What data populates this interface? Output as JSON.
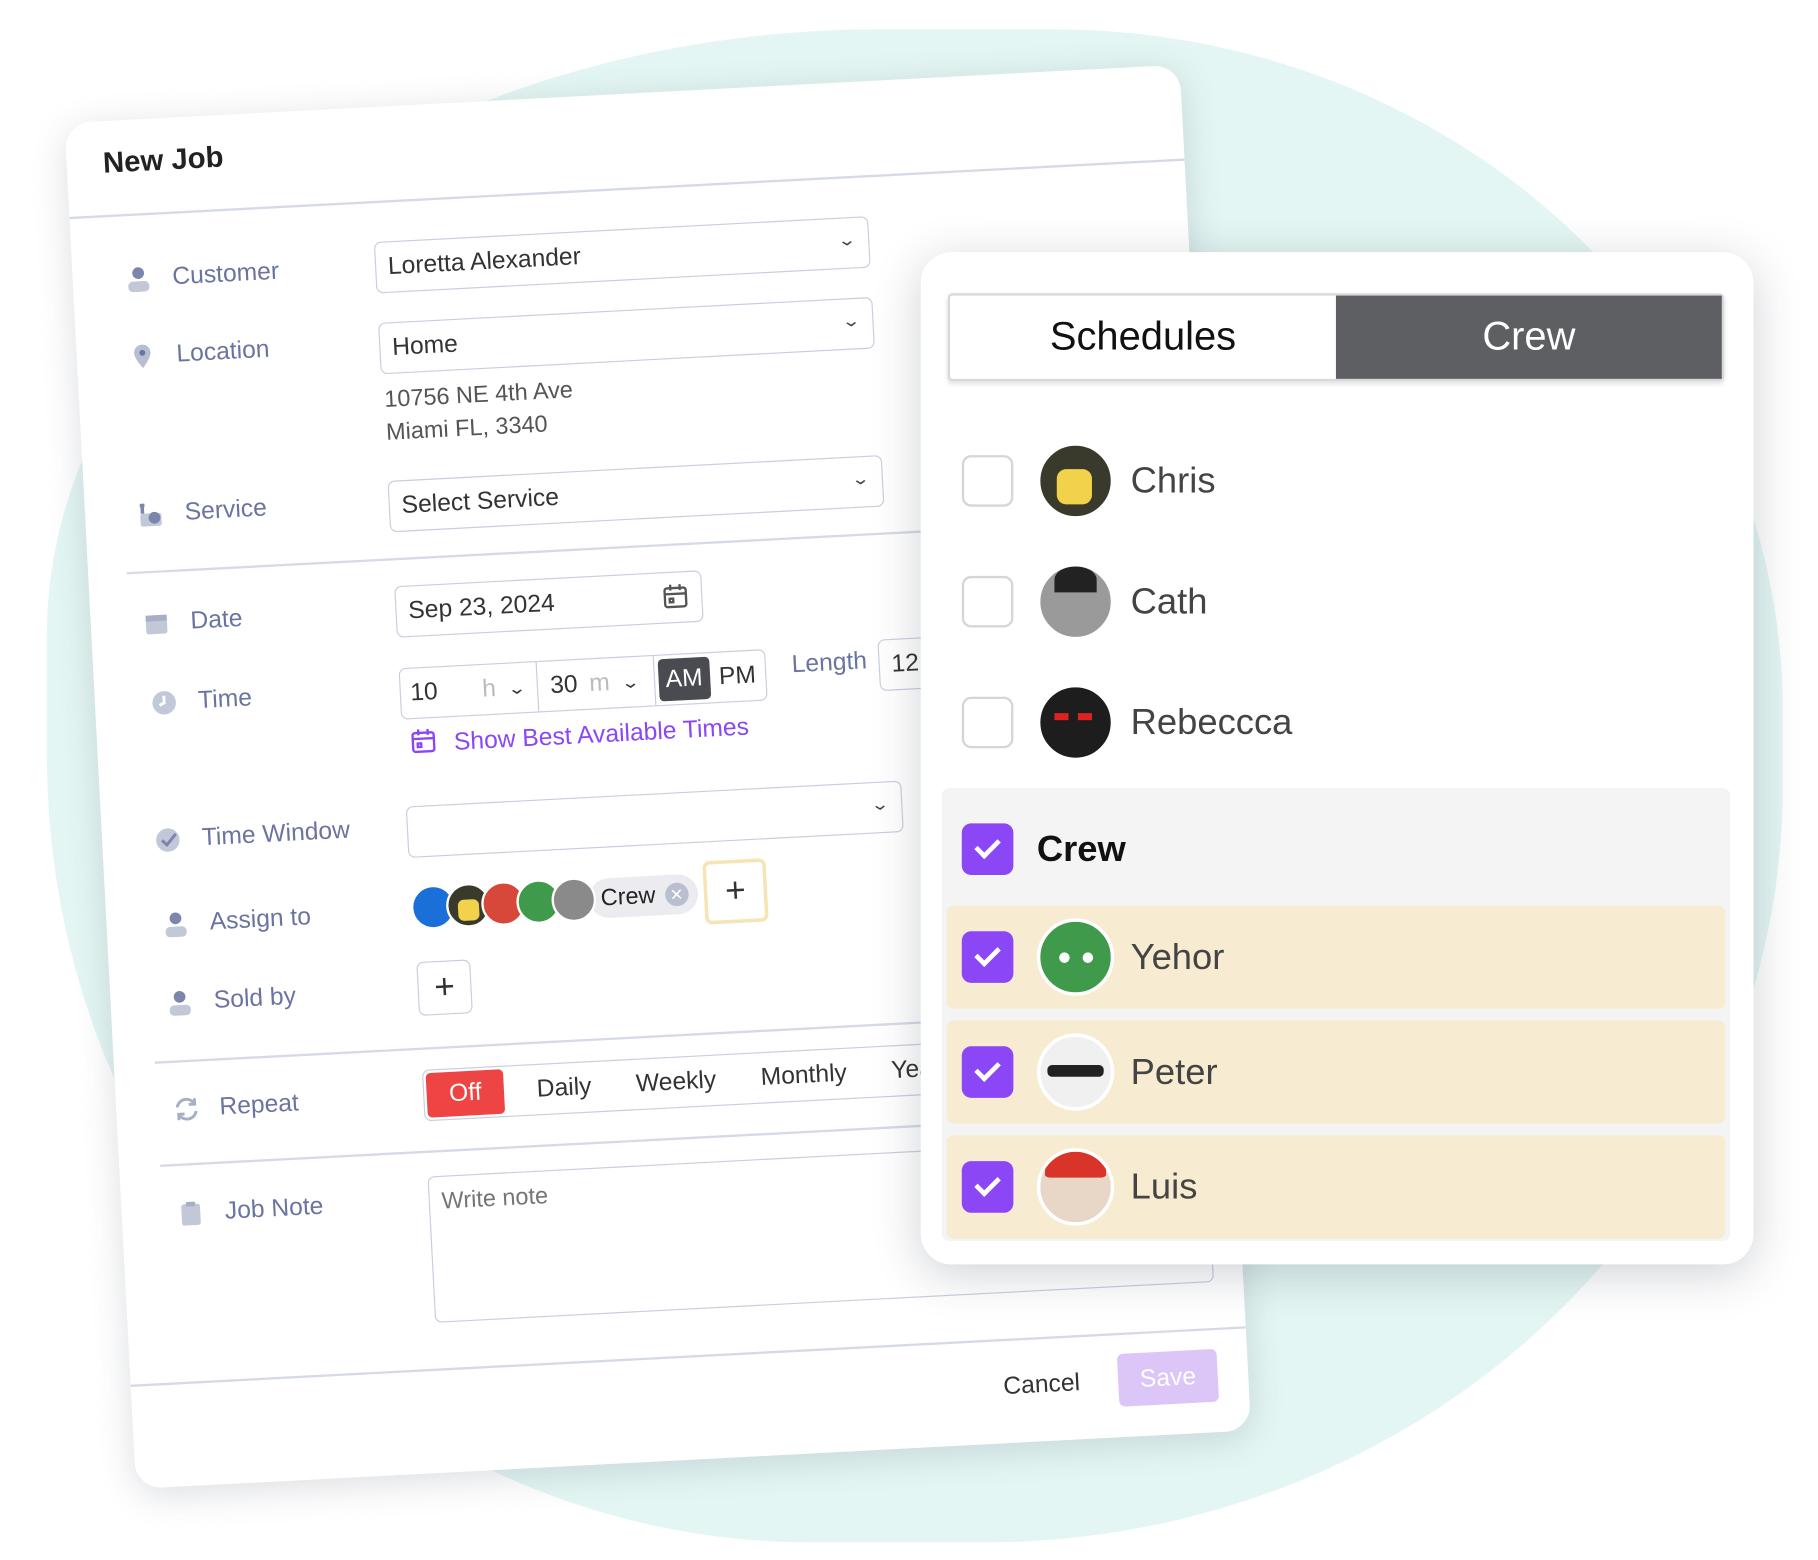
{
  "form": {
    "title": "New Job",
    "customer": {
      "label": "Customer",
      "value": "Loretta Alexander"
    },
    "location": {
      "label": "Location",
      "value": "Home",
      "address_line1": "10756 NE 4th Ave",
      "address_line2": "Miami FL, 3340"
    },
    "service": {
      "label": "Service",
      "value": "Select Service"
    },
    "date": {
      "label": "Date",
      "value": "Sep 23, 2024"
    },
    "time": {
      "label": "Time",
      "hour": "10",
      "hour_unit": "h",
      "minute": "30",
      "minute_unit": "m",
      "am": "AM",
      "pm": "PM",
      "selected_period": "AM",
      "length_label": "Length",
      "length_value": "12"
    },
    "show_best_times": "Show Best Available Times",
    "time_window": {
      "label": "Time Window",
      "value": ""
    },
    "assign_to": {
      "label": "Assign to",
      "chip_label": "Crew",
      "add": "+"
    },
    "sold_by": {
      "label": "Sold by",
      "add": "+"
    },
    "repeat": {
      "label": "Repeat",
      "options": [
        "Off",
        "Daily",
        "Weekly",
        "Monthly",
        "Yearly"
      ],
      "selected": "Off"
    },
    "job_note": {
      "label": "Job Note",
      "placeholder": "Write note"
    },
    "cancel": "Cancel",
    "save": "Save"
  },
  "panel": {
    "tabs": [
      "Schedules",
      "Crew"
    ],
    "active_tab": "Crew",
    "people": [
      {
        "name": "Chris",
        "checked": false
      },
      {
        "name": "Cath",
        "checked": false
      },
      {
        "name": "Rebeccca",
        "checked": false
      }
    ],
    "group": {
      "name": "Crew",
      "checked": true,
      "members": [
        {
          "name": "Yehor",
          "checked": true
        },
        {
          "name": "Peter",
          "checked": true
        },
        {
          "name": "Luis",
          "checked": true
        }
      ]
    }
  },
  "colors": {
    "accent": "#8b46f5",
    "off_red": "#ee4444",
    "member_bg": "#f7ecd2",
    "tab_active": "#5e5f63",
    "background_blob": "#e3f6f3",
    "save_disabled": "#dcc6f7"
  }
}
